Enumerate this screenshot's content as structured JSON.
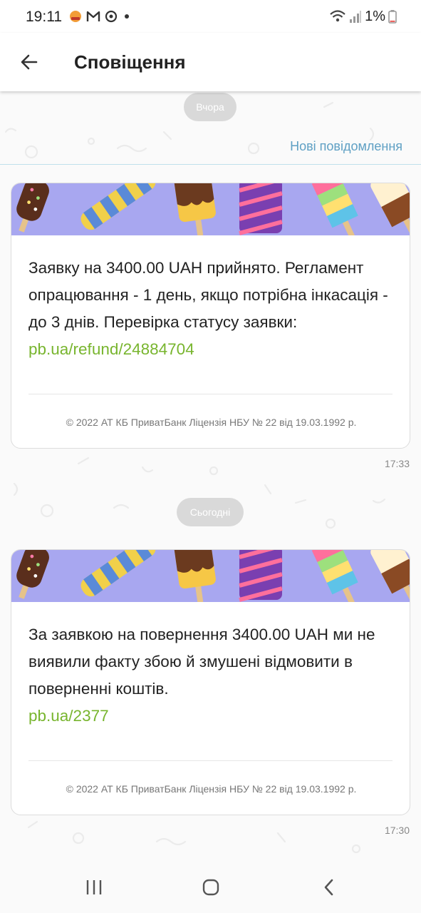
{
  "status_bar": {
    "time": "19:11",
    "battery": "1%",
    "icons": [
      "notification-app-icon",
      "gmail-icon",
      "sync-icon",
      "dot-icon",
      "wifi-icon",
      "signal-icon",
      "battery-icon"
    ]
  },
  "app_bar": {
    "title": "Сповіщення",
    "back_icon": "arrow-left-icon"
  },
  "new_messages_label": "Нові повідомлення",
  "days": [
    {
      "label": "Вчора",
      "message": {
        "text": "Заявку на 3400.00 UAH прийнято. Регламент опрацювання - 1 день, якщо потрібна інкасація - до 3 днів. Перевірка статусу заявки: ",
        "link": "pb.ua/refund/24884704",
        "footer": "© 2022 АТ КБ ПриватБанк Ліцензія НБУ № 22 від 19.03.1992 р.",
        "time": "17:33"
      }
    },
    {
      "label": "Сьогодні",
      "message": {
        "text": "За заявкою на повернення 3400.00 UAH ми не виявили факту збою й змушені відмовити в поверненні коштів.",
        "link": "pb.ua/2377",
        "footer": "© 2022 АТ КБ ПриватБанк Ліцензія НБУ № 22 від 19.03.1992 р.",
        "time": "17:30"
      }
    }
  ],
  "colors": {
    "link": "#78b52e",
    "new_messages": "#5fa0c4",
    "banner_bg": "#a8a7f0",
    "pill_bg": "#d9d9d9"
  },
  "nav_bar": {
    "icons": [
      "recents-icon",
      "home-icon",
      "back-icon"
    ]
  }
}
